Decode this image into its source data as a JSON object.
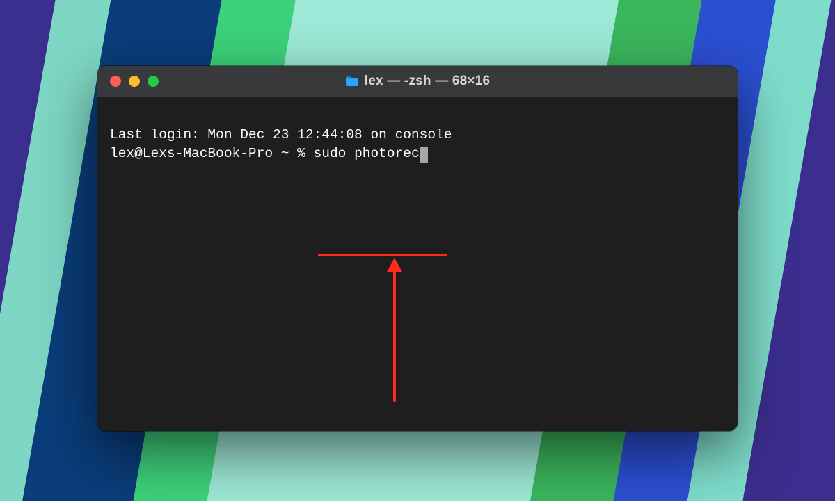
{
  "window": {
    "title": "lex — -zsh — 68×16",
    "icon": "folder-icon",
    "traffic_colors": {
      "close": "#ff5f57",
      "min": "#febc2e",
      "max": "#28c840"
    }
  },
  "terminal": {
    "last_login_line": "Last login: Mon Dec 23 12:44:08 on console",
    "prompt_prefix": "lex@Lexs-MacBook-Pro ~ % ",
    "command": "sudo photorec"
  },
  "annotation": {
    "type": "underline-with-up-arrow",
    "color": "#ff2a1a",
    "target": "command"
  }
}
